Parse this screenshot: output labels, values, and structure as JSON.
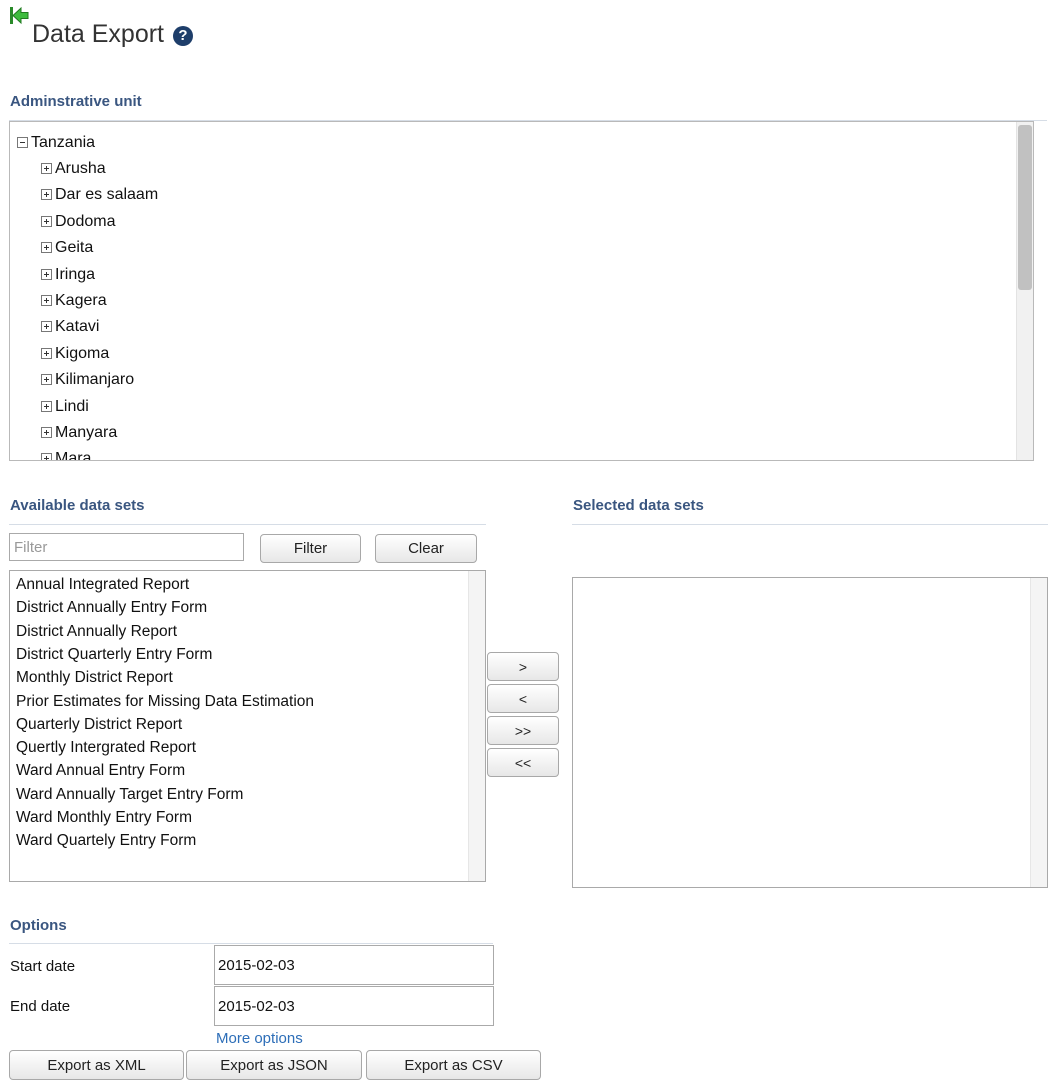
{
  "header": {
    "title": "Data Export",
    "back_icon": "back-arrow-icon",
    "help_icon": "question-circle-icon",
    "help_glyph": "?"
  },
  "admin_unit": {
    "heading": "Adminstrative unit",
    "root": "Tanzania",
    "children": [
      "Arusha",
      "Dar es salaam",
      "Dodoma",
      "Geita",
      "Iringa",
      "Kagera",
      "Katavi",
      "Kigoma",
      "Kilimanjaro",
      "Lindi",
      "Manyara",
      "Mara"
    ]
  },
  "available": {
    "heading": "Available data sets",
    "filter_placeholder": "Filter",
    "filter_button": "Filter",
    "clear_button": "Clear",
    "items": [
      "Annual Integrated Report",
      "District Annually Entry Form",
      "District Annually Report",
      "District Quarterly Entry Form",
      "Monthly District Report",
      "Prior Estimates for Missing Data Estimation",
      "Quarterly District Report",
      "Quertly Intergrated Report",
      "Ward Annual Entry Form",
      "Ward Annually Target Entry Form",
      "Ward Monthly Entry Form",
      "Ward Quartely Entry Form"
    ]
  },
  "move_buttons": {
    "add": ">",
    "remove": "<",
    "add_all": ">>",
    "remove_all": "<<"
  },
  "selected": {
    "heading": "Selected data sets",
    "items": []
  },
  "options": {
    "heading": "Options",
    "start_label": "Start date",
    "start_value": "2015-02-03",
    "end_label": "End date",
    "end_value": "2015-02-03",
    "more_options": "More options"
  },
  "export": {
    "xml": "Export as XML",
    "json": "Export as JSON",
    "csv": "Export as CSV"
  },
  "colors": {
    "heading": "#3a5680",
    "link": "#2d6eb8",
    "help_icon": "#1e3e6a",
    "back_arrow": "#2fa52f"
  }
}
